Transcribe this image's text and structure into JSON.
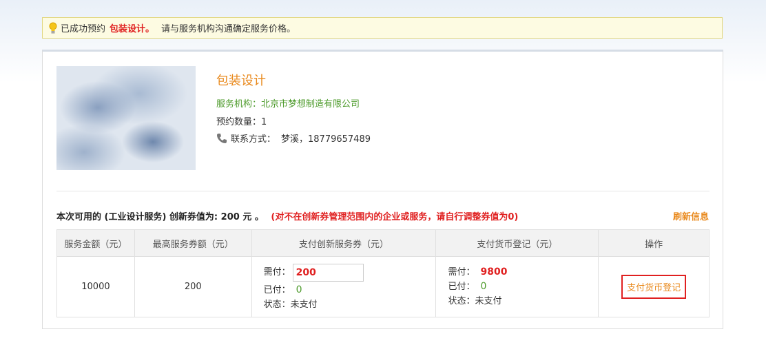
{
  "notice": {
    "prefix": "已成功预约",
    "service": "包装设计。",
    "rest": "请与服务机构沟通确定服务价格。"
  },
  "service": {
    "title": "包装设计",
    "org": "服务机构：北京市梦想制造有限公司",
    "qty": "预约数量：1",
    "contact_label": "联系方式：",
    "contact_value": "梦溪，18779657489"
  },
  "summary": {
    "text": "本次可用的 (工业设计服务) 创新券值为: 200 元 。",
    "warning": "(对不在创新券管理范围内的企业或服务，请自行调整券值为0)",
    "refresh": "刷新信息"
  },
  "table": {
    "headers": [
      "服务金额（元）",
      "最高服务券额（元）",
      "支付创新服务券（元）",
      "支付货币登记（元）",
      "操作"
    ],
    "row": {
      "amount": "10000",
      "max_voucher": "200",
      "voucher": {
        "need_label": "需付：",
        "need_value": "200",
        "paid_label": "已付：",
        "paid_value": "0",
        "status": "状态：未支付"
      },
      "currency": {
        "need_label": "需付：",
        "need_value": "9800",
        "paid_label": "已付：",
        "paid_value": "0",
        "status": "状态：未支付"
      },
      "action": "支付货币登记"
    }
  },
  "colors": {
    "accent_orange": "#e98a1e",
    "alert_red": "#e02020",
    "green": "#4c9a2a"
  },
  "icons": [
    "lightbulb-icon",
    "phone-icon"
  ]
}
